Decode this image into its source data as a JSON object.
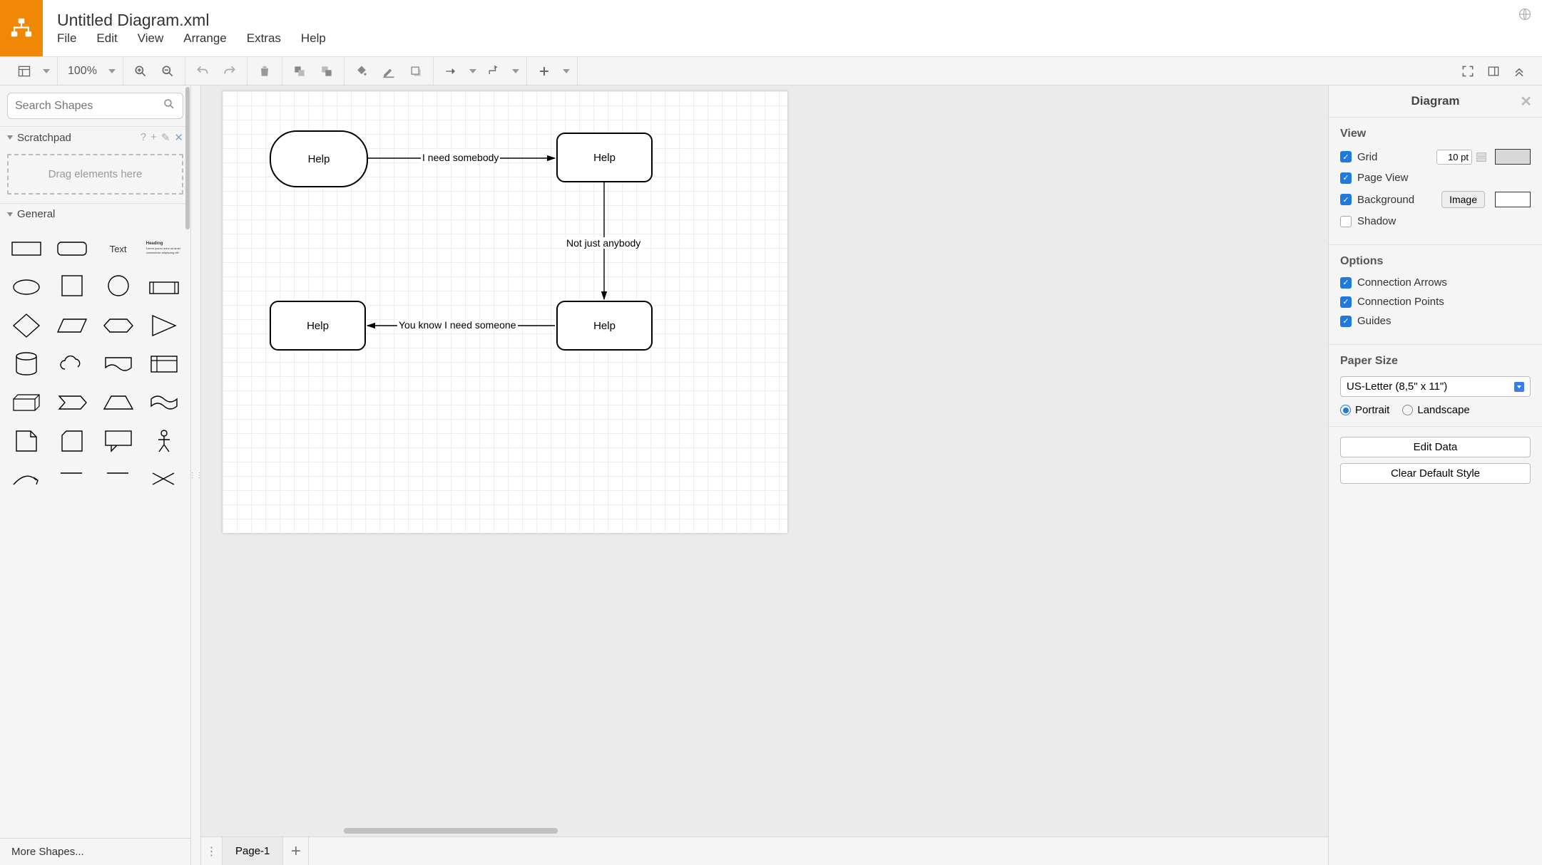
{
  "title": "Untitled Diagram.xml",
  "menu": [
    "File",
    "Edit",
    "View",
    "Arrange",
    "Extras",
    "Help"
  ],
  "zoom": "100%",
  "search_placeholder": "Search Shapes",
  "scratchpad": {
    "title": "Scratchpad",
    "drop": "Drag elements here"
  },
  "general": {
    "title": "General",
    "text_label": "Text",
    "heading_label": "Heading"
  },
  "more_shapes": "More Shapes...",
  "tabs": {
    "page1": "Page-1"
  },
  "canvas": {
    "nodes": {
      "n1": "Help",
      "n2": "Help",
      "n3": "Help",
      "n4": "Help"
    },
    "edges": {
      "e1": "I need somebody",
      "e2": "Not just anybody",
      "e3": "You know I need someone"
    }
  },
  "right": {
    "title": "Diagram",
    "view": {
      "h": "View",
      "grid": "Grid",
      "grid_size": "10 pt",
      "page_view": "Page View",
      "background": "Background",
      "image_btn": "Image",
      "shadow": "Shadow"
    },
    "options": {
      "h": "Options",
      "conn_arrows": "Connection Arrows",
      "conn_points": "Connection Points",
      "guides": "Guides"
    },
    "paper": {
      "h": "Paper Size",
      "size": "US-Letter (8,5\" x 11\")",
      "portrait": "Portrait",
      "landscape": "Landscape"
    },
    "edit_data": "Edit Data",
    "clear_style": "Clear Default Style"
  }
}
